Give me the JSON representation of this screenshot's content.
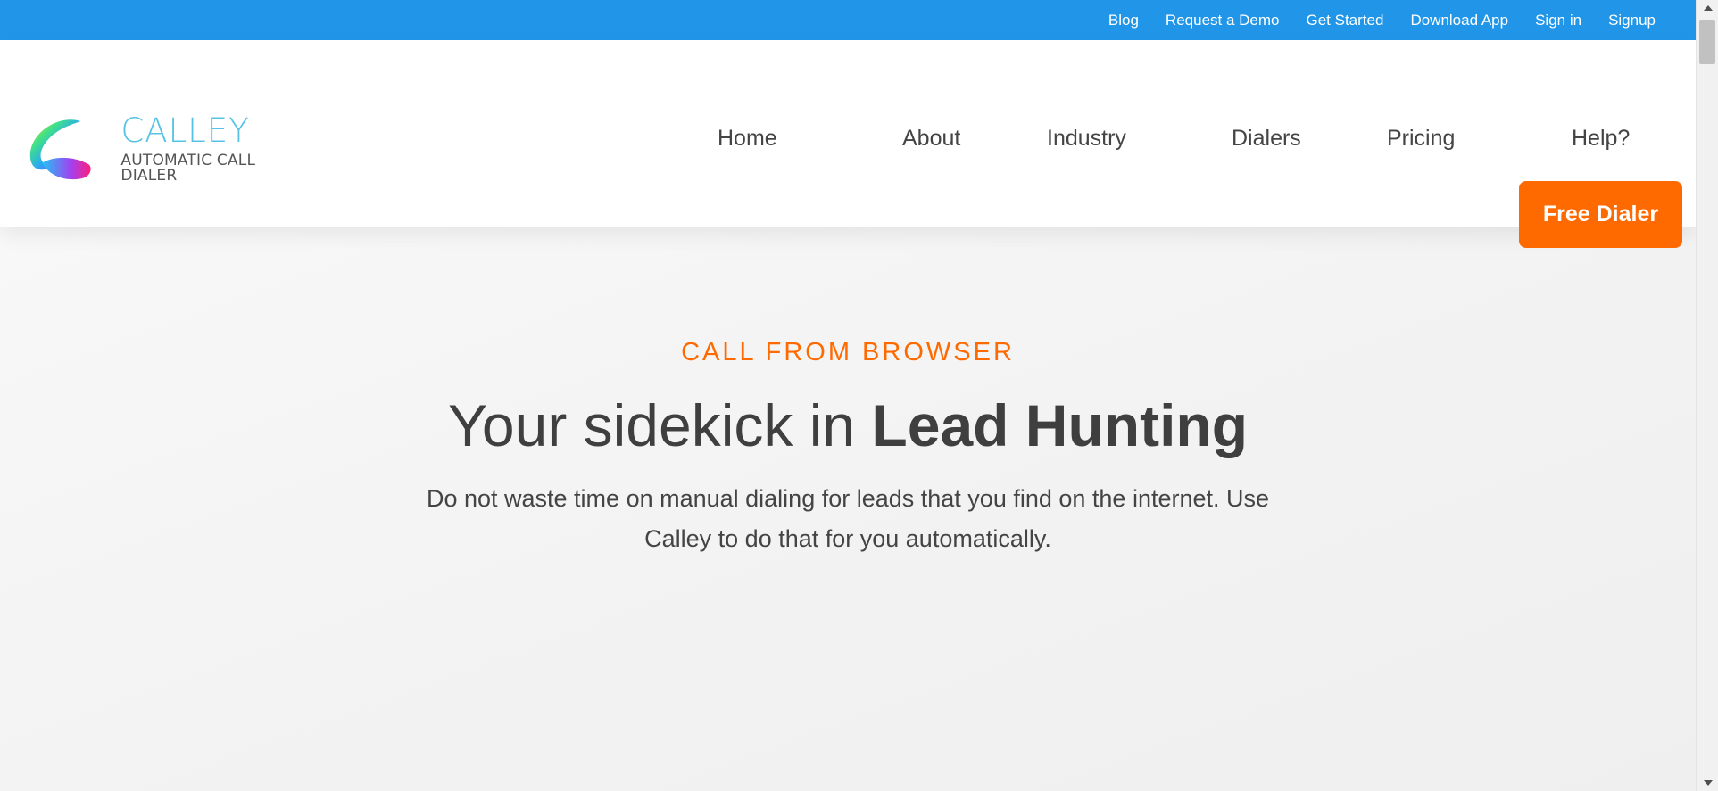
{
  "topbar": {
    "links": [
      "Blog",
      "Request a Demo",
      "Get Started",
      "Download App",
      "Sign in",
      "Signup"
    ]
  },
  "logo": {
    "name": "CALLEY",
    "tagline": "AUTOMATIC CALL DIALER"
  },
  "nav": {
    "items": [
      "Home",
      "About",
      "Industry",
      "Dialers",
      "Pricing",
      "Help?"
    ],
    "cta": "Free Dialer"
  },
  "hero": {
    "eyebrow": "CALL FROM BROWSER",
    "headline_regular": "Your sidekick in ",
    "headline_bold": "Lead Hunting",
    "subtext_line1": "Do not waste time on manual dialing for leads that you find on the internet. Use",
    "subtext_line2": "Calley to do that for you automatically."
  },
  "colors": {
    "topbar": "#2196e8",
    "accent": "#ff6a00",
    "logo_name": "#56c3e6",
    "text": "#3f3f3f"
  }
}
